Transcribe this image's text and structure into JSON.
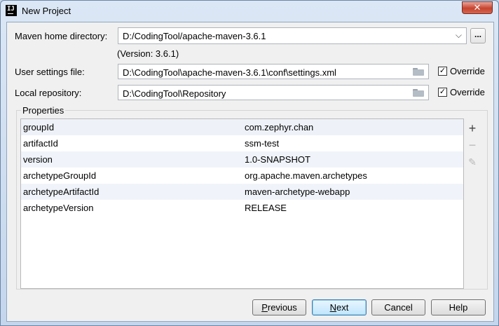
{
  "window": {
    "title": "New Project",
    "close_label": "✕"
  },
  "maven_home": {
    "label": "Maven home directory:",
    "value": "D:/CodingTool/apache-maven-3.6.1",
    "version_text": "(Version: 3.6.1)",
    "browse_label": "..."
  },
  "user_settings": {
    "label": "User settings file:",
    "value": "D:\\CodingTool\\apache-maven-3.6.1\\conf\\settings.xml",
    "override_label": "Override",
    "override_checked": true
  },
  "local_repo": {
    "label": "Local repository:",
    "value": "D:\\CodingTool\\Repository",
    "override_label": "Override",
    "override_checked": true
  },
  "properties": {
    "title": "Properties",
    "rows": [
      {
        "key": "groupId",
        "value": "com.zephyr.chan"
      },
      {
        "key": "artifactId",
        "value": "ssm-test"
      },
      {
        "key": "version",
        "value": "1.0-SNAPSHOT"
      },
      {
        "key": "archetypeGroupId",
        "value": "org.apache.maven.archetypes"
      },
      {
        "key": "archetypeArtifactId",
        "value": "maven-archetype-webapp"
      },
      {
        "key": "archetypeVersion",
        "value": "RELEASE"
      }
    ],
    "add_icon": "plus-icon",
    "remove_icon": "minus-icon",
    "edit_icon": "pencil-icon"
  },
  "buttons": {
    "previous_first": "P",
    "previous_rest": "revious",
    "next_first": "N",
    "next_rest": "ext",
    "cancel": "Cancel",
    "help": "Help"
  }
}
